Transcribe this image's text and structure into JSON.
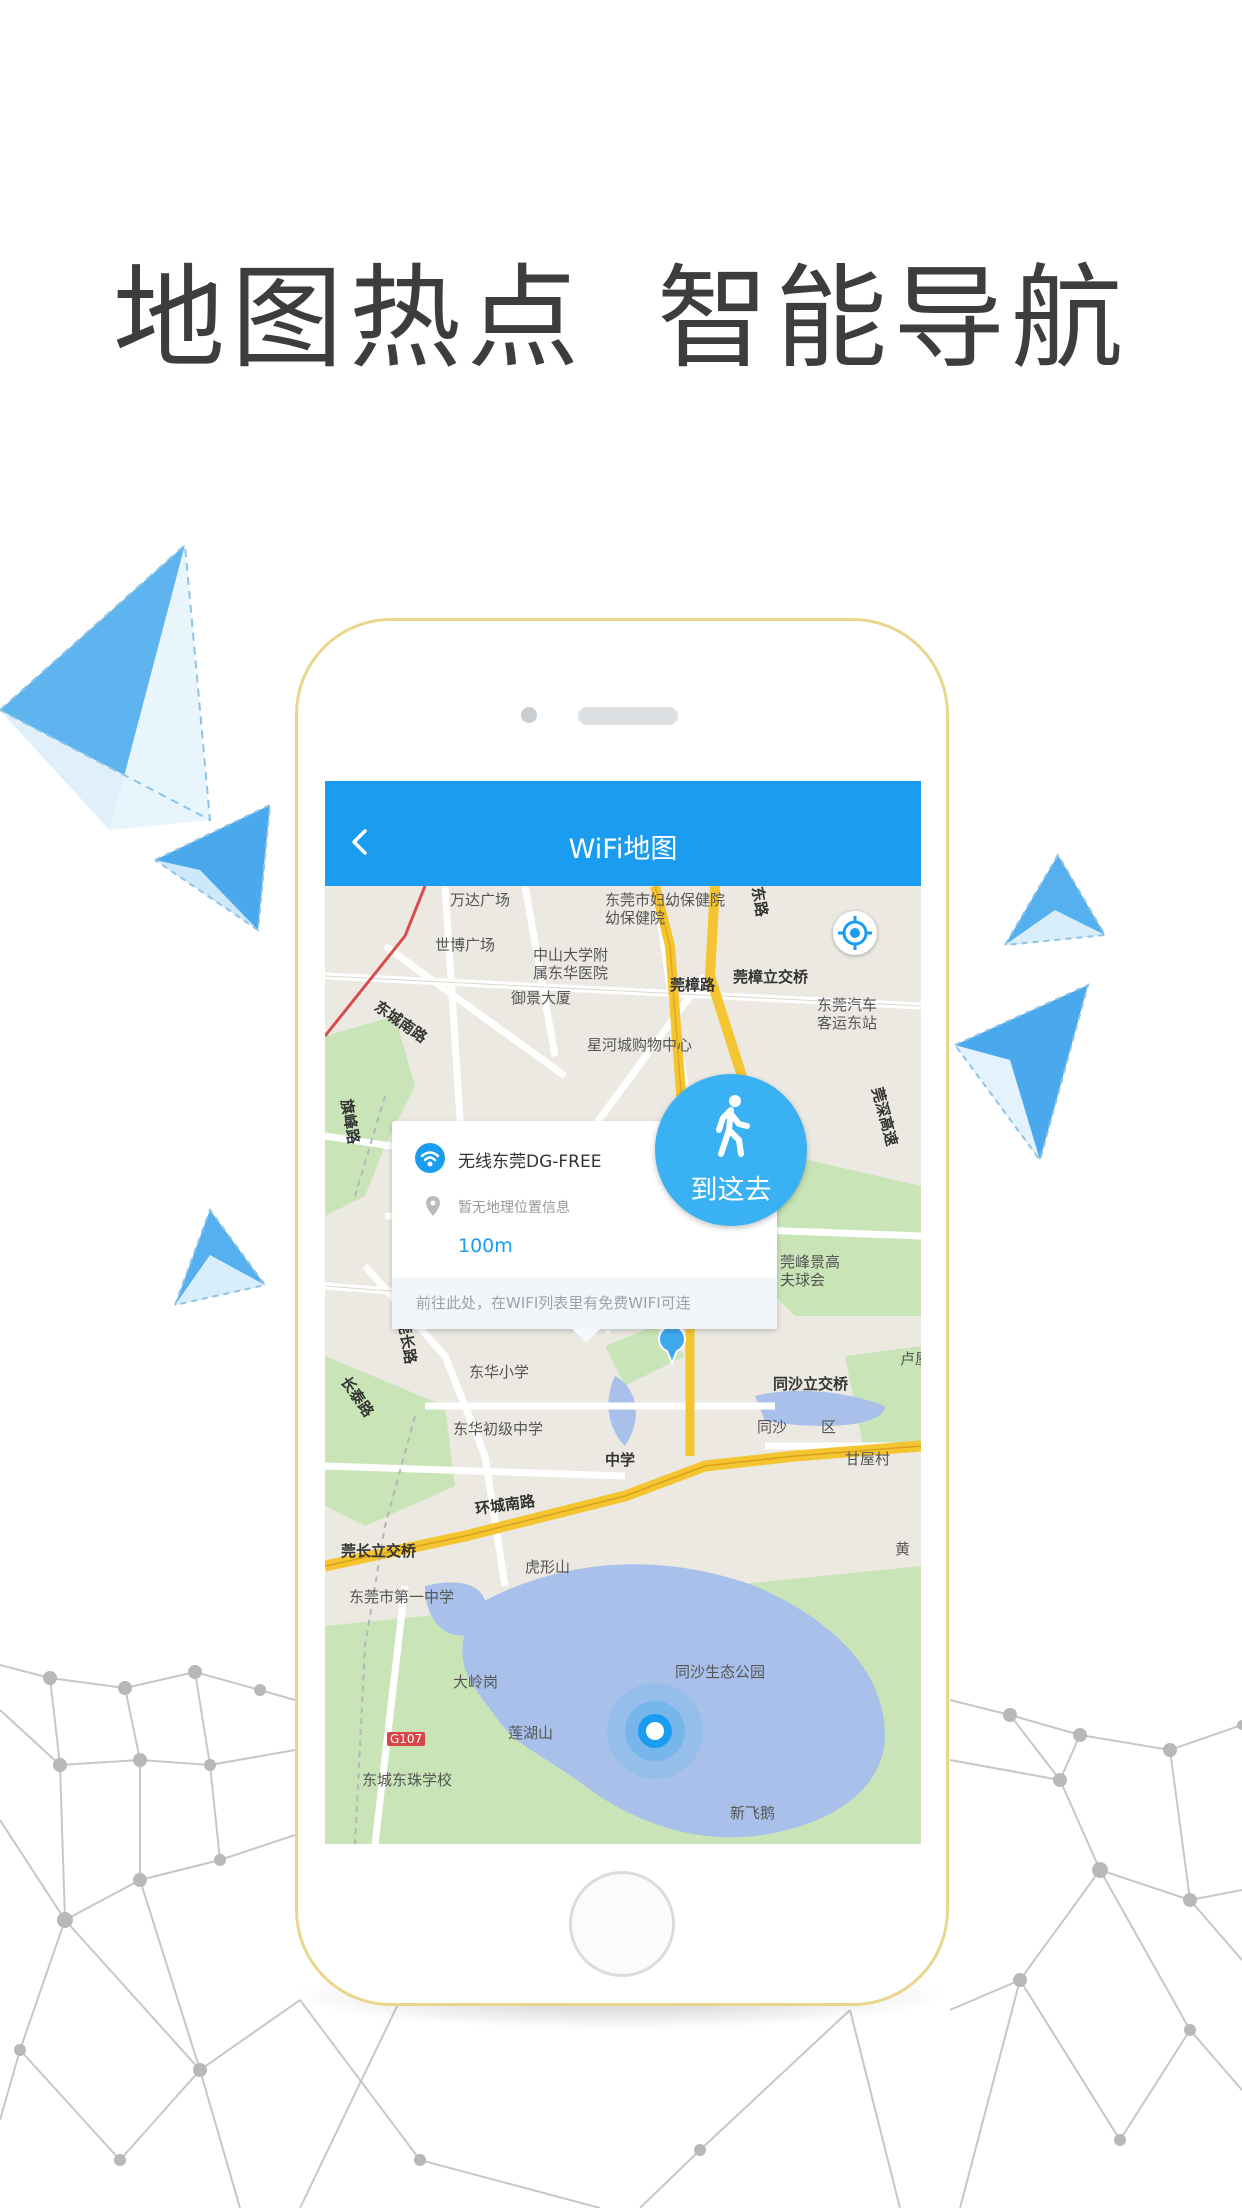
{
  "headline": {
    "part1": "地图热点",
    "part2": "智能导航"
  },
  "app": {
    "title": "WiFi地图",
    "back_icon": "chevron-left-icon"
  },
  "popup": {
    "ssid": "无线东莞DG-FREE",
    "address": "暂无地理位置信息",
    "distance": "100m",
    "footer": "前往此处，在WIFI列表里有免费WIFI可连"
  },
  "go_button": {
    "label": "到这去",
    "icon": "walking-person-icon"
  },
  "locate_button": {
    "icon": "locate-crosshair-icon"
  },
  "map": {
    "labels": {
      "wanda": "万达广场",
      "maternity": "东莞市妇幼保健院",
      "maternity2": "幼保健院",
      "shibo": "世博广场",
      "zhongshan1": "中山大学附",
      "zhongshan2": "属东华医院",
      "yujing": "御景大厦",
      "guanzhang_rd": "莞樟路",
      "guanzhang_bridge": "莞樟立交桥",
      "bus1": "东莞汽车",
      "bus2": "客运东站",
      "xinghe": "星河城购物中心",
      "dongcheng_s": "东城南路",
      "qifeng": "旗峰路",
      "dong_rd": "东路",
      "guanshen": "莞深高速",
      "jingfeng": "莞峰景高",
      "jingfeng2": "夫球会",
      "guanchang": "莞长路",
      "changtai": "长泰路",
      "donghua_xiao": "东华小学",
      "donghua_mid": "东华初级中学",
      "tongsha_bridge": "同沙立交桥",
      "tongsha": "同沙",
      "qu": "区",
      "ganwu": "甘屋村",
      "luzhi": "卢屋",
      "huancheng": "环城南路",
      "guanchang_bridge": "莞长立交桥",
      "huxing": "虎形山",
      "dg1": "东莞市第一中学",
      "daling": "大岭岗",
      "eco_park": "同沙生态公园",
      "g107": "G107",
      "lianhu": "莲湖山",
      "dongzhu": "东城东珠学校",
      "xinfei": "新飞鹅",
      "huang": "黄",
      "zhong": "中学"
    }
  },
  "colors": {
    "brand_blue": "#1a9df0",
    "go_button": "#3ab1f3",
    "headline": "#3d3d3d",
    "phone_frame": "#ead58d",
    "water": "#a9c1ea",
    "green": "#c9e5b8",
    "highway": "#f5c531"
  }
}
